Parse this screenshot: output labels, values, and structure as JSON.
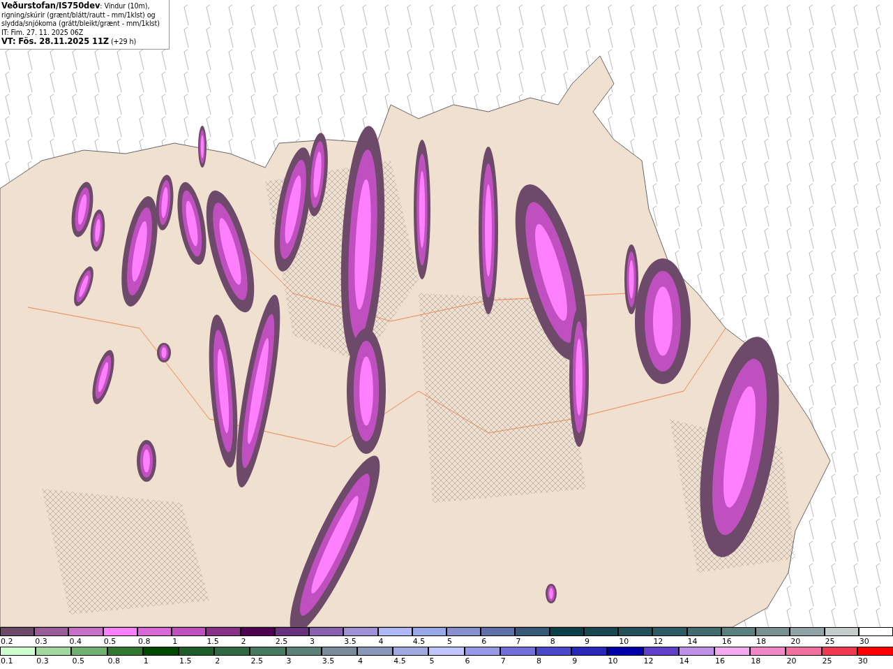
{
  "header": {
    "description": "**Veðurstofan/IS750dev**: Vindur (10m), rigning/skúrir (grænt/blátt/rautt - mm/1klst) og slydda/snjókoma (grátt/bleikt/grænt - mm/1klst)",
    "issue_time": "IT: Fim. 27. 11. 2025 06Z",
    "valid_time": "**VT: Fös. 28.11.2025 11Z** (+29 h)"
  },
  "legends": [
    {
      "items": [
        {
          "label": "0.2",
          "color": "#6e4a6a"
        },
        {
          "label": "0.3",
          "color": "#9a5c96"
        },
        {
          "label": "0.4",
          "color": "#c870c8"
        },
        {
          "label": "0.5",
          "color": "#ff80ff"
        },
        {
          "label": "0.8",
          "color": "#d868d8"
        },
        {
          "label": "1",
          "color": "#c050c0"
        },
        {
          "label": "1.5",
          "color": "#8a3088"
        },
        {
          "label": "2",
          "color": "#500050"
        },
        {
          "label": "2.5",
          "color": "#6a3080"
        },
        {
          "label": "3",
          "color": "#8a60b0"
        },
        {
          "label": "3.5",
          "color": "#a090d8"
        },
        {
          "label": "4",
          "color": "#b0b8f8"
        },
        {
          "label": "4.5",
          "color": "#98a8e8"
        },
        {
          "label": "5",
          "color": "#8890d0"
        },
        {
          "label": "6",
          "color": "#6070a8"
        },
        {
          "label": "7",
          "color": "#385878"
        },
        {
          "label": "8",
          "color": "#0a4048"
        },
        {
          "label": "9",
          "color": "#184850"
        },
        {
          "label": "10",
          "color": "#205058"
        },
        {
          "label": "12",
          "color": "#2e5c64"
        },
        {
          "label": "14",
          "color": "#406c70"
        },
        {
          "label": "16",
          "color": "#5a8080"
        },
        {
          "label": "18",
          "color": "#789090"
        },
        {
          "label": "20",
          "color": "#90a4a8"
        },
        {
          "label": "25",
          "color": "#c4cccc"
        },
        {
          "label": "30",
          "color": "#ffffff"
        }
      ]
    },
    {
      "items": [
        {
          "label": "0.1",
          "color": "#ccffcc"
        },
        {
          "label": "0.3",
          "color": "#a0d8a0"
        },
        {
          "label": "0.5",
          "color": "#70b070"
        },
        {
          "label": "0.8",
          "color": "#307830"
        },
        {
          "label": "1",
          "color": "#004800"
        },
        {
          "label": "1.5",
          "color": "#1c5c28"
        },
        {
          "label": "2",
          "color": "#2e6840"
        },
        {
          "label": "2.5",
          "color": "#467a60"
        },
        {
          "label": "3",
          "color": "#5a8078"
        },
        {
          "label": "3.5",
          "color": "#788c9c"
        },
        {
          "label": "4",
          "color": "#8898b8"
        },
        {
          "label": "4.5",
          "color": "#a0aae0"
        },
        {
          "label": "5",
          "color": "#c0c4ff"
        },
        {
          "label": "6",
          "color": "#9898e8"
        },
        {
          "label": "7",
          "color": "#7070d8"
        },
        {
          "label": "8",
          "color": "#4848c8"
        },
        {
          "label": "9",
          "color": "#2828b8"
        },
        {
          "label": "10",
          "color": "#0000a8"
        },
        {
          "label": "12",
          "color": "#6040c8"
        },
        {
          "label": "14",
          "color": "#c090e8"
        },
        {
          "label": "16",
          "color": "#f4a8f0"
        },
        {
          "label": "18",
          "color": "#f088c8"
        },
        {
          "label": "20",
          "color": "#f070a0"
        },
        {
          "label": "25",
          "color": "#f03850"
        },
        {
          "label": "30",
          "color": "#ff0000"
        }
      ]
    }
  ]
}
